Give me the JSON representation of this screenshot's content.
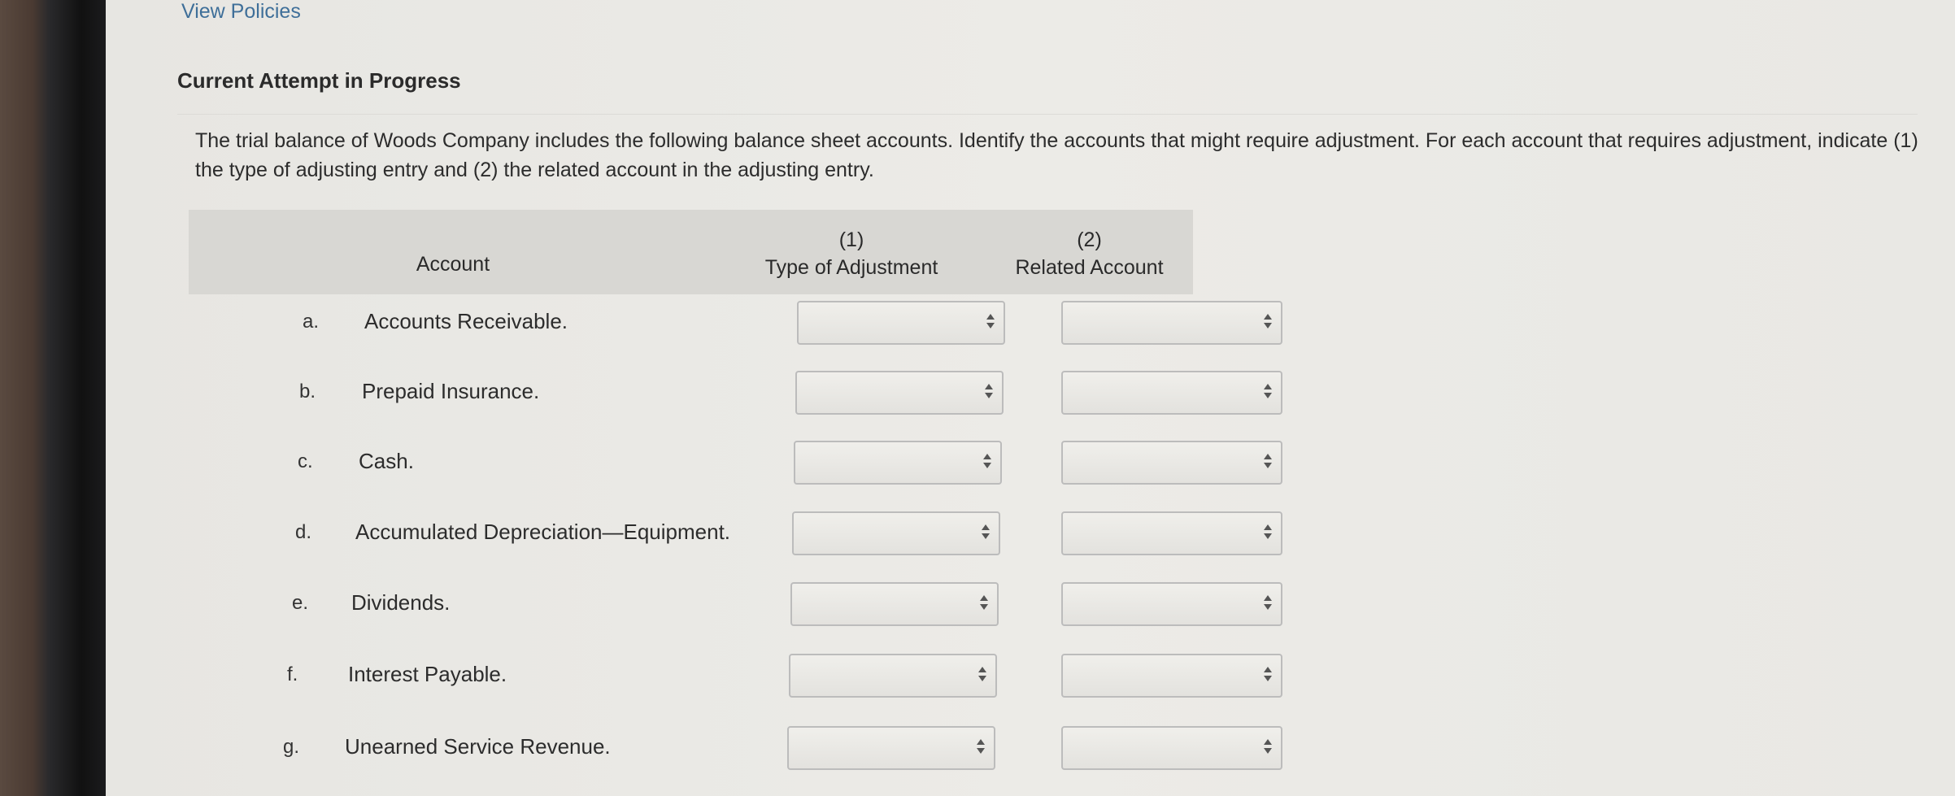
{
  "header": {
    "view_policies": "View Policies",
    "attempt_title": "Current Attempt in Progress"
  },
  "question": {
    "text": "The trial balance of Woods Company includes the following balance sheet accounts. Identify the accounts that might require adjustment. For each account that requires adjustment, indicate (1) the type of adjusting entry and (2) the related account in the adjusting entry."
  },
  "table": {
    "headers": {
      "account": "Account",
      "type_num": "(1)",
      "type_label": "Type of Adjustment",
      "related_num": "(2)",
      "related_label": "Related Account"
    },
    "rows": [
      {
        "letter": "a.",
        "account": "Accounts Receivable."
      },
      {
        "letter": "b.",
        "account": "Prepaid Insurance."
      },
      {
        "letter": "c.",
        "account": "Cash."
      },
      {
        "letter": "d.",
        "account": "Accumulated Depreciation—Equipment."
      },
      {
        "letter": "e.",
        "account": "Dividends."
      },
      {
        "letter": "f.",
        "account": "Interest Payable."
      },
      {
        "letter": "g.",
        "account": "Unearned Service Revenue."
      }
    ]
  },
  "icons": {
    "select_caret": "updown-caret-icon"
  }
}
